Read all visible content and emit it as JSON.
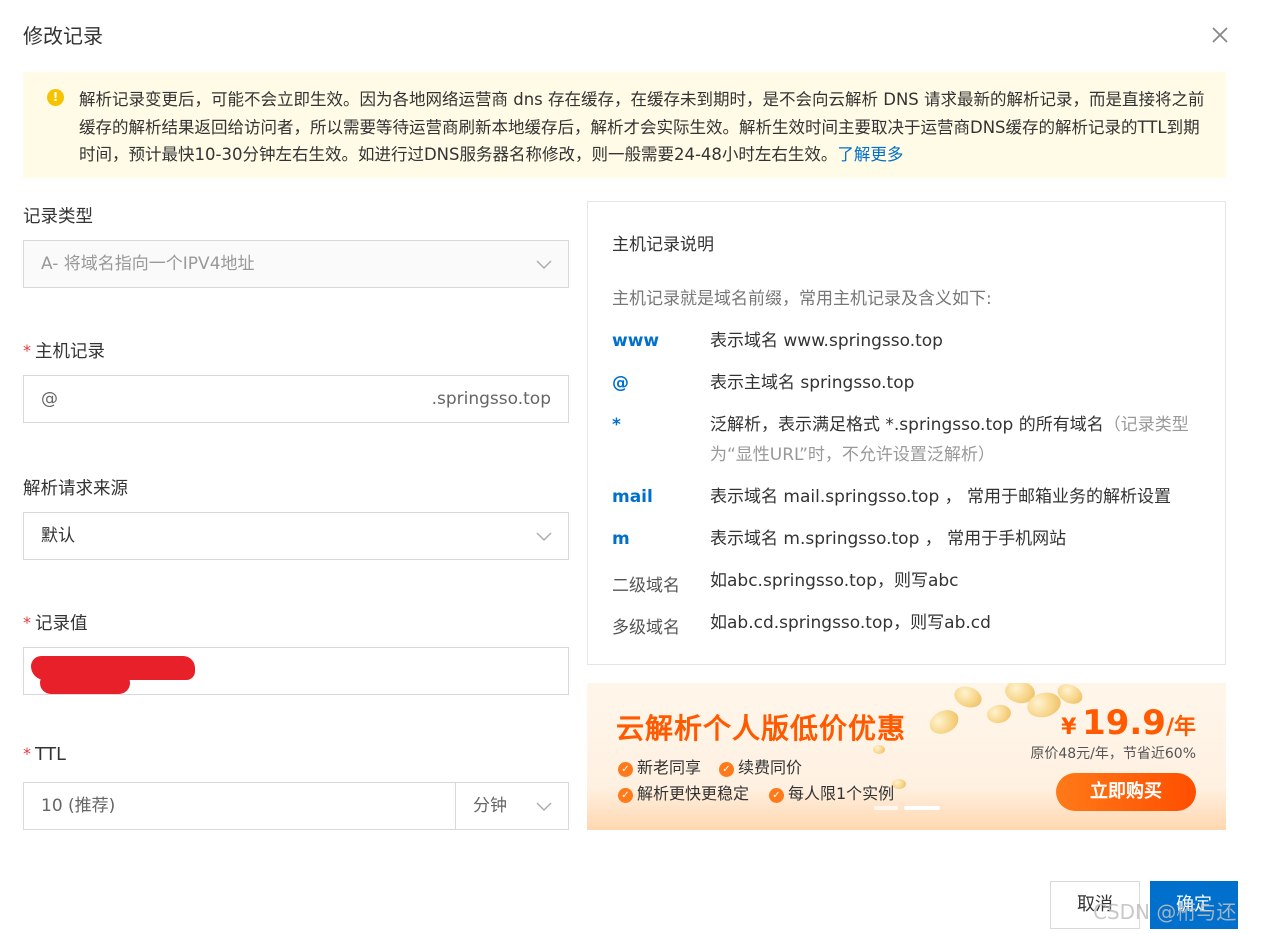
{
  "dialog": {
    "title": "修改记录"
  },
  "notice": {
    "icon": "warning-icon",
    "text": "解析记录变更后，可能不会立即生效。因为各地网络运营商 dns 存在缓存，在缓存未到期时，是不会向云解析 DNS 请求最新的解析记录，而是直接将之前缓存的解析结果返回给访问者，所以需要等待运营商刷新本地缓存后，解析才会实际生效。解析生效时间主要取决于运营商DNS缓存的解析记录的TTL到期时间，预计最快10-30分钟左右生效。如进行过DNS服务器名称修改，则一般需要24-48小时左右生效。",
    "link": "了解更多"
  },
  "form": {
    "record_type": {
      "label": "记录类型",
      "value": "A- 将域名指向一个IPV4地址"
    },
    "host": {
      "required_mark": "*",
      "label": "主机记录",
      "value": "@",
      "suffix": ".springsso.top"
    },
    "source": {
      "label": "解析请求来源",
      "value": "默认"
    },
    "record_value": {
      "required_mark": "*",
      "label": "记录值"
    },
    "ttl": {
      "required_mark": "*",
      "label": "TTL",
      "value": "10 (推荐)",
      "unit": "分钟"
    }
  },
  "help": {
    "title": "主机记录说明",
    "intro": "主机记录就是域名前缀，常用主机记录及含义如下:",
    "rows": [
      {
        "key": "www",
        "desc": "表示域名 www.springsso.top",
        "note": ""
      },
      {
        "key": "@",
        "desc": "表示主域名 springsso.top",
        "note": ""
      },
      {
        "key": "*",
        "desc": "泛解析，表示满足格式 *.springsso.top 的所有域名",
        "note": "（记录类型为“显性URL”时，不允许设置泛解析）"
      },
      {
        "key": "mail",
        "desc": "表示域名 mail.springsso.top ， 常用于邮箱业务的解析设置",
        "note": ""
      },
      {
        "key": "m",
        "desc": "表示域名 m.springsso.top ， 常用于手机网站",
        "note": ""
      },
      {
        "key": "二级域名",
        "desc": "如abc.springsso.top，则写abc",
        "note": ""
      },
      {
        "key": "多级域名",
        "desc": "如ab.cd.springsso.top，则写ab.cd",
        "note": ""
      }
    ]
  },
  "promo": {
    "title": "云解析个人版低价优惠",
    "features": [
      "新老同享",
      "续费同价",
      "解析更快更稳定",
      "每人限1个实例"
    ],
    "price_currency": "¥",
    "price_value": "19.9",
    "price_unit": "/年",
    "original_price": "原价48元/年，节省近60%",
    "buy_label": "立即购买"
  },
  "footer": {
    "cancel_label": "取消",
    "ok_label": "确定"
  },
  "watermark": "CSDN @桁与还"
}
